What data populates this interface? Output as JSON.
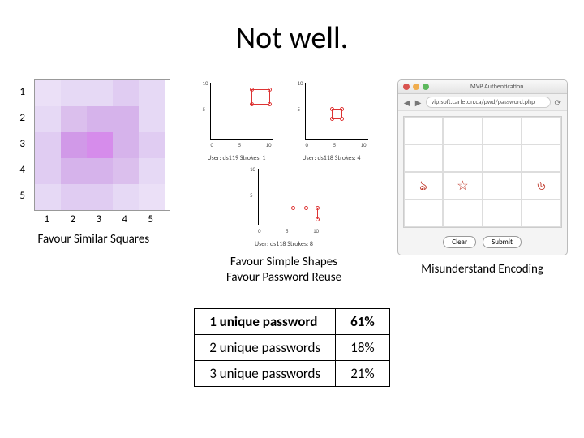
{
  "title": "Not well.",
  "captions": {
    "left": "Favour Similar Squares",
    "mid_line1": "Favour Simple Shapes",
    "mid_line2": "Favour Password Reuse",
    "right": "Misunderstand Encoding"
  },
  "table": {
    "rows": [
      {
        "label": "1 unique password",
        "pct": "61%"
      },
      {
        "label": "2 unique passwords",
        "pct": "18%"
      },
      {
        "label": "3 unique passwords",
        "pct": "21%"
      }
    ]
  },
  "browser": {
    "title": "MVP Authentication",
    "url": "vip.soft.carleton.ca/pwd/password.php",
    "clear": "Clear",
    "submit": "Submit",
    "sketches": [
      "ঌ",
      "☆",
      "৬"
    ]
  },
  "scatter": {
    "labels": [
      "User: ds119 Strokes: 1",
      "User: ds118 Strokes: 4",
      "User: ds118 Strokes: 8"
    ]
  },
  "chart_data": {
    "type": "heatmap",
    "title": "",
    "xlabel": "",
    "ylabel": "",
    "x": [
      1,
      2,
      3,
      4,
      5
    ],
    "y": [
      1,
      2,
      3,
      4,
      5
    ],
    "values": [
      [
        [
          0.92,
          0.88,
          0.97
        ],
        [
          0.9,
          0.85,
          0.96
        ],
        [
          0.9,
          0.85,
          0.96
        ],
        [
          0.88,
          0.8,
          0.95
        ],
        [
          0.9,
          0.85,
          0.96
        ]
      ],
      [
        [
          0.9,
          0.85,
          0.96
        ],
        [
          0.86,
          0.75,
          0.93
        ],
        [
          0.84,
          0.7,
          0.92
        ],
        [
          0.84,
          0.7,
          0.92
        ],
        [
          0.9,
          0.85,
          0.96
        ]
      ],
      [
        [
          0.88,
          0.8,
          0.95
        ],
        [
          0.82,
          0.6,
          0.91
        ],
        [
          0.84,
          0.55,
          0.92
        ],
        [
          0.84,
          0.7,
          0.92
        ],
        [
          0.88,
          0.8,
          0.95
        ]
      ],
      [
        [
          0.88,
          0.8,
          0.95
        ],
        [
          0.84,
          0.7,
          0.92
        ],
        [
          0.84,
          0.7,
          0.92
        ],
        [
          0.86,
          0.75,
          0.93
        ],
        [
          0.9,
          0.85,
          0.96
        ]
      ],
      [
        [
          0.9,
          0.85,
          0.96
        ],
        [
          0.88,
          0.8,
          0.95
        ],
        [
          0.88,
          0.8,
          0.95
        ],
        [
          0.9,
          0.85,
          0.96
        ],
        [
          0.92,
          0.88,
          0.97
        ]
      ]
    ],
    "note": "values are approximate RGB fractions per cell read from screenshot colors"
  },
  "heatmap_ticks": {
    "y": [
      "1",
      "2",
      "3",
      "4",
      "5"
    ],
    "x": [
      "1",
      "2",
      "3",
      "4",
      "5"
    ]
  }
}
